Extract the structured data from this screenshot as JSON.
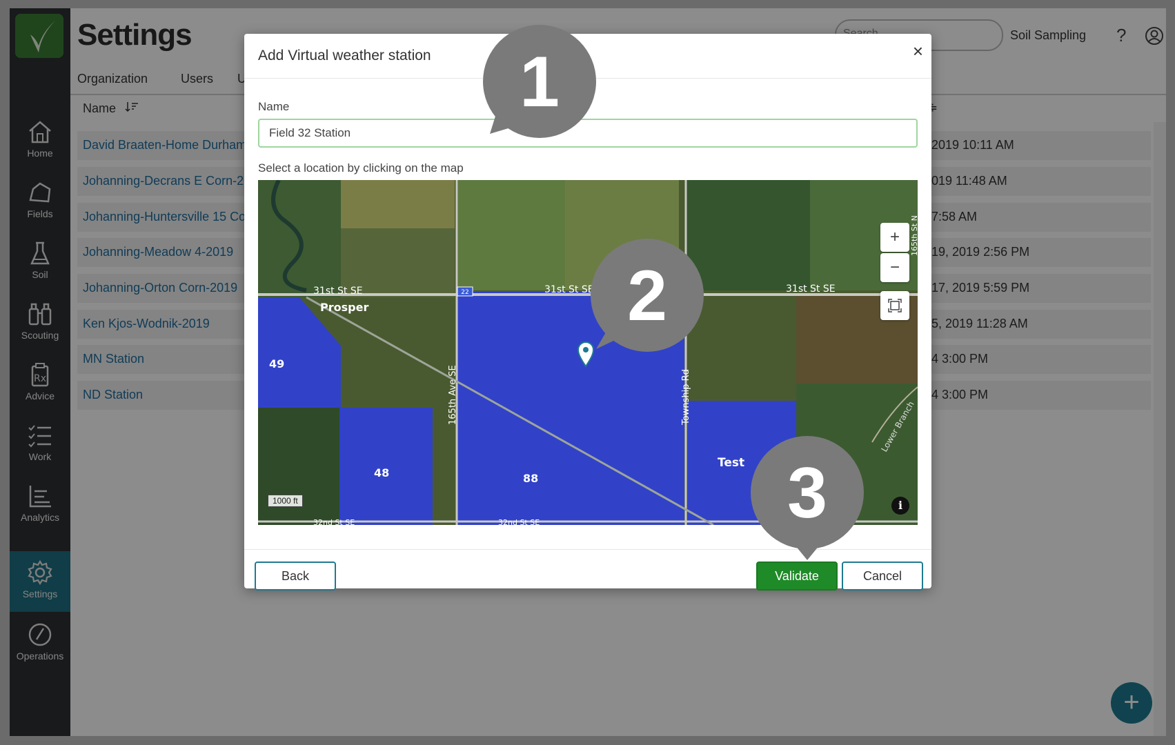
{
  "sidebar": {
    "items": [
      {
        "label": "Home",
        "icon": "home-icon"
      },
      {
        "label": "Fields",
        "icon": "field-icon"
      },
      {
        "label": "Soil",
        "icon": "beaker-icon"
      },
      {
        "label": "Scouting",
        "icon": "binoculars-icon"
      },
      {
        "label": "Advice",
        "icon": "prescription-icon"
      },
      {
        "label": "Work",
        "icon": "checklist-icon"
      },
      {
        "label": "Analytics",
        "icon": "chart-icon"
      },
      {
        "label": "Settings",
        "icon": "gear-icon"
      },
      {
        "label": "Operations",
        "icon": "gauge-icon"
      }
    ],
    "active": "Settings"
  },
  "header": {
    "title": "Settings",
    "search_placeholder": "Search",
    "top_link": "Soil Sampling",
    "help": "?"
  },
  "tabs": [
    "Organization",
    "Users",
    "U"
  ],
  "table": {
    "name_header": "Name",
    "rows": [
      {
        "name": "David Braaten-Home Durham",
        "date": "2019 10:11 AM"
      },
      {
        "name": "Johanning-Decrans E Corn-20",
        "date": "019 11:48 AM"
      },
      {
        "name": "Johanning-Huntersville 15 Co",
        "date": "7:58 AM"
      },
      {
        "name": "Johanning-Meadow 4-2019",
        "date": "19, 2019 2:56 PM"
      },
      {
        "name": "Johanning-Orton Corn-2019",
        "date": "17, 2019 5:59 PM"
      },
      {
        "name": "Ken Kjos-Wodnik-2019",
        "date": "5, 2019 11:28 AM"
      },
      {
        "name": "MN Station",
        "date": "4 3:00 PM"
      },
      {
        "name": "ND Station",
        "date": "4 3:00 PM"
      }
    ]
  },
  "modal": {
    "title": "Add Virtual weather station",
    "close": "×",
    "name_label": "Name",
    "name_value": "Field 32 Station",
    "map_label": "Select a location by clicking on the map",
    "map": {
      "roads": [
        "31st St SE",
        "31st St SE",
        "31st St SE",
        "165th Ave SE",
        "Township Rd",
        "32nd St SE",
        "32nd St SE",
        "Lower Branch",
        "165th St N",
        "22"
      ],
      "town": "Prosper",
      "field_labels": [
        "49",
        "48",
        "88",
        "Test"
      ],
      "scale": "1000 ft",
      "zoom_in": "+",
      "zoom_out": "−",
      "info": "i"
    },
    "back_label": "Back",
    "validate_label": "Validate",
    "cancel_label": "Cancel"
  },
  "callouts": [
    "1",
    "2",
    "3"
  ],
  "fab": "+",
  "colors": {
    "sidebar": "#2f3133",
    "active_nav": "#1e6f82",
    "link": "#1f6e9e",
    "validate": "#1f8a28",
    "field_fill": "#2f3fd9",
    "callout": "#7a7a7a"
  }
}
